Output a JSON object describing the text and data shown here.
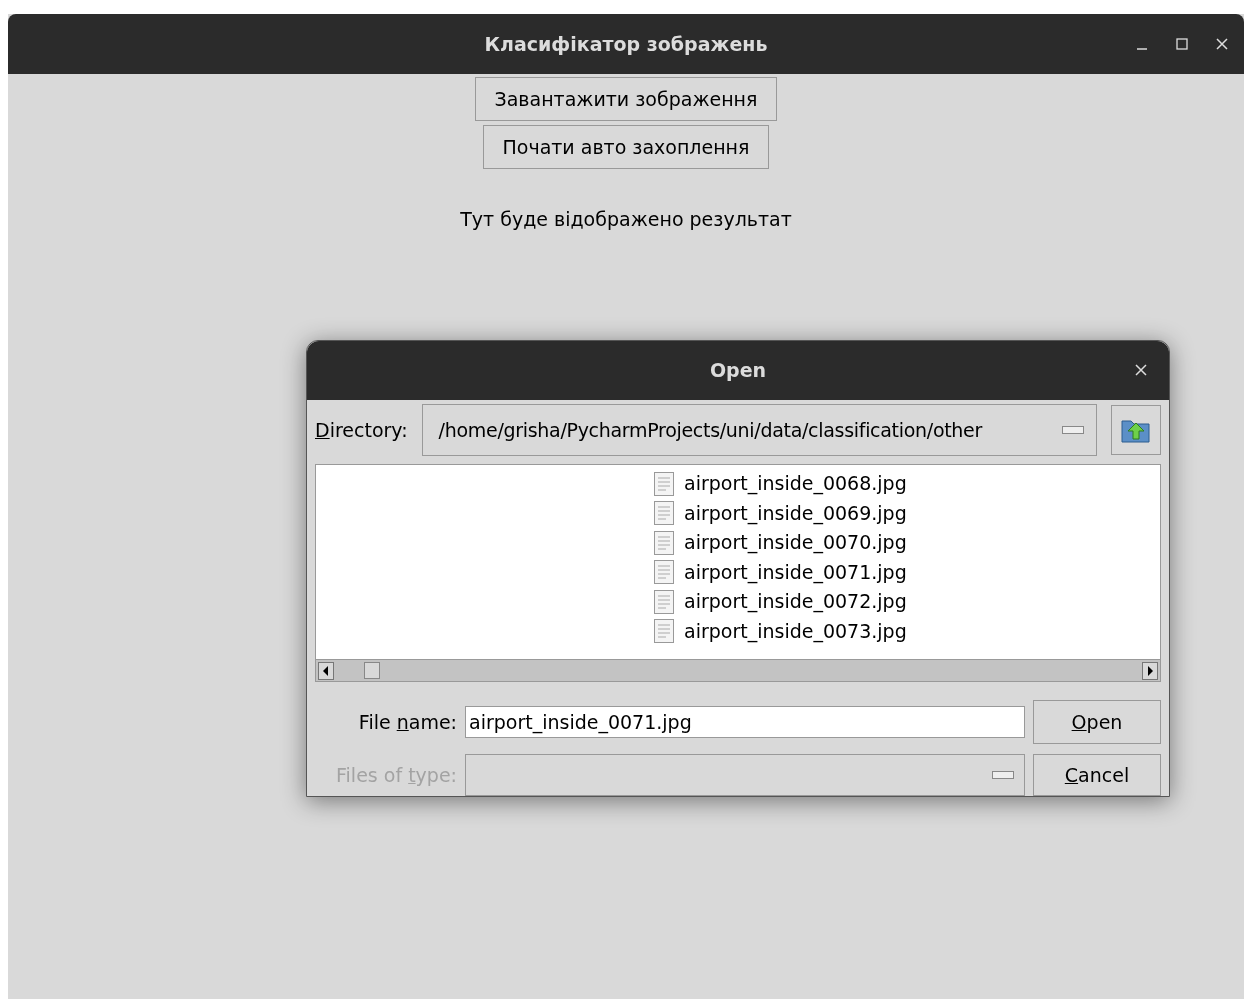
{
  "window": {
    "title": "Класифікатор зображень"
  },
  "buttons": [
    {
      "label": "Завантажити зображення"
    },
    {
      "label": "Почати авто захоплення"
    }
  ],
  "result_label": "Тут буде відображено результат",
  "dialog": {
    "title": "Open",
    "directory": {
      "label": {
        "mnemonic": "D",
        "after": "irectory:"
      },
      "value": "/home/grisha/PycharmProjects/uni/data/classification/other"
    },
    "files": [
      {
        "name": "airport_inside_0068.jpg"
      },
      {
        "name": "airport_inside_0069.jpg"
      },
      {
        "name": "airport_inside_0070.jpg"
      },
      {
        "name": "airport_inside_0071.jpg"
      },
      {
        "name": "airport_inside_0072.jpg"
      },
      {
        "name": "airport_inside_0073.jpg"
      }
    ],
    "file_name": {
      "label": {
        "before": "File ",
        "mnemonic": "n",
        "after": "ame:"
      },
      "value": "airport_inside_0071.jpg"
    },
    "files_of_type": {
      "label": {
        "before": "Files of ",
        "mnemonic": "t",
        "after": "ype:"
      },
      "disabled": true
    },
    "open_button": {
      "label": {
        "mnemonic": "O",
        "after": "pen"
      }
    },
    "cancel_button": {
      "label": {
        "mnemonic": "C",
        "after": "ancel"
      }
    }
  }
}
